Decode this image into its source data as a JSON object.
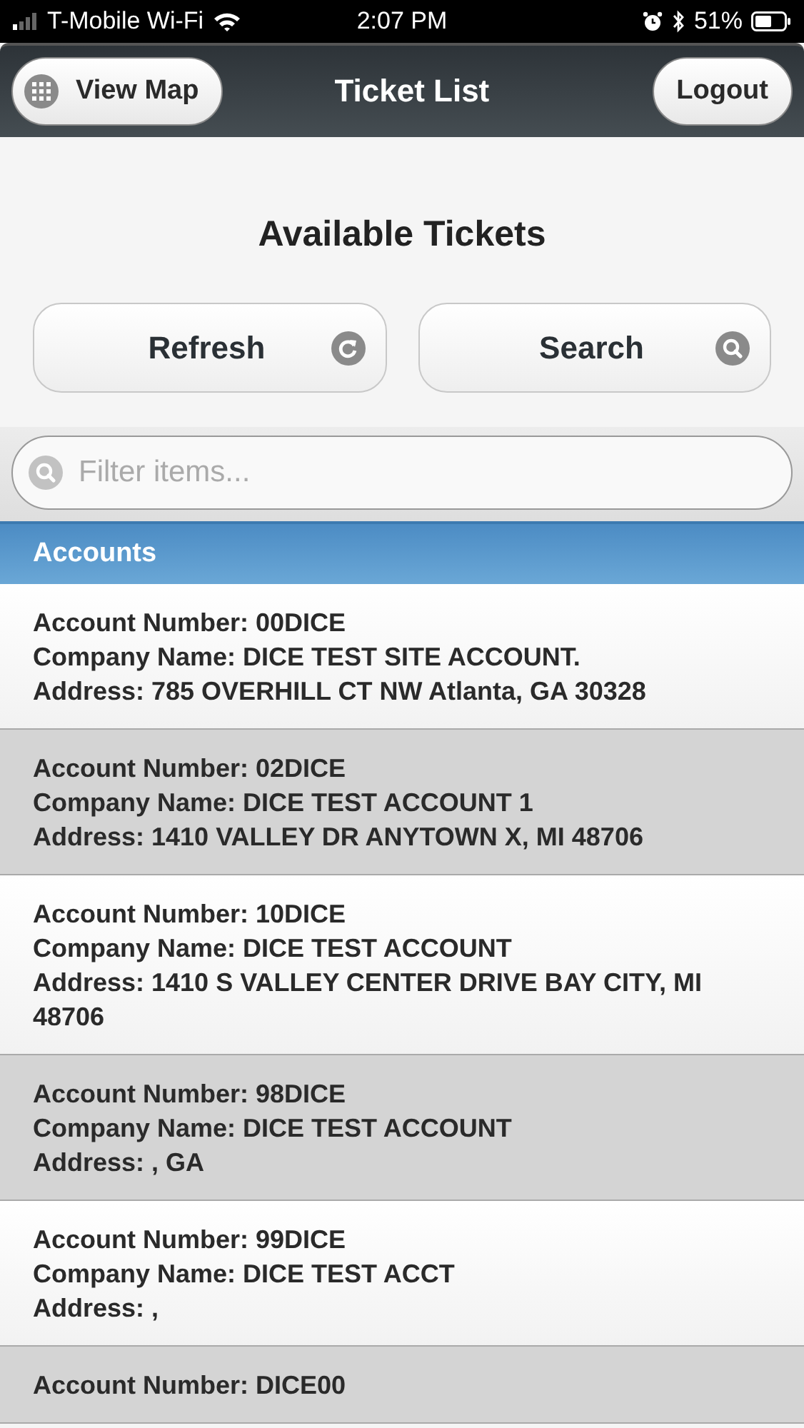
{
  "status_bar": {
    "carrier": "T-Mobile Wi-Fi",
    "time": "2:07 PM",
    "battery": "51%"
  },
  "header": {
    "left_button": "View Map",
    "title": "Ticket List",
    "right_button": "Logout"
  },
  "heading": "Available Tickets",
  "actions": [
    {
      "label": "Refresh",
      "kind": "refresh"
    },
    {
      "label": "Search",
      "kind": "search"
    }
  ],
  "filter": {
    "placeholder": "Filter items..."
  },
  "list": {
    "divider": "Accounts",
    "items": [
      {
        "lines": [
          "Account Number: 00DICE",
          "Company Name: DICE TEST SITE ACCOUNT.",
          "Address: 785 OVERHILL CT NW Atlanta, GA 30328"
        ]
      },
      {
        "lines": [
          "Account Number: 02DICE",
          "Company Name: DICE TEST ACCOUNT 1",
          "Address: 1410 VALLEY DR ANYTOWN X, MI 48706"
        ]
      },
      {
        "lines": [
          "Account Number: 10DICE",
          "Company Name: DICE TEST ACCOUNT",
          "Address: 1410 S VALLEY CENTER DRIVE BAY CITY, MI 48706"
        ]
      },
      {
        "lines": [
          "Account Number: 98DICE",
          "Company Name: DICE TEST ACCOUNT",
          "Address: , GA"
        ]
      },
      {
        "lines": [
          "Account Number: 99DICE",
          "Company Name: DICE TEST ACCT",
          "Address: ,"
        ]
      },
      {
        "lines": [
          "Account Number: DICE00"
        ]
      }
    ]
  }
}
